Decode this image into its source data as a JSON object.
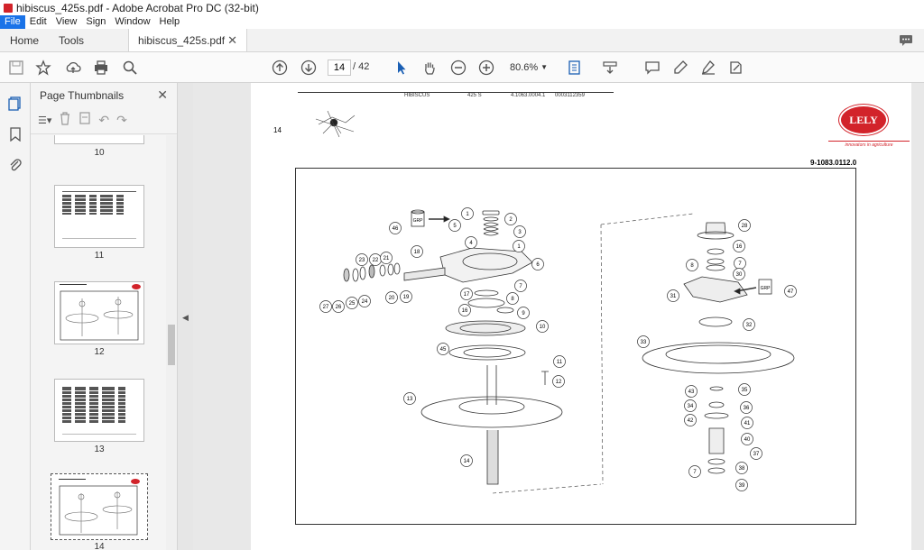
{
  "window": {
    "title": "hibiscus_425s.pdf - Adobe Acrobat Pro DC (32-bit)"
  },
  "menu": {
    "items": [
      "File",
      "Edit",
      "View",
      "Sign",
      "Window",
      "Help"
    ]
  },
  "tabs": {
    "home": "Home",
    "tools": "Tools",
    "document": "hibiscus_425s.pdf"
  },
  "toolbar": {
    "current_page": "14",
    "total_pages": "/ 42",
    "zoom": "80.6%"
  },
  "panel": {
    "title": "Page Thumbnails",
    "thumbnails": [
      {
        "label": "10"
      },
      {
        "label": "11"
      },
      {
        "label": "12"
      },
      {
        "label": "13"
      },
      {
        "label": "14"
      }
    ]
  },
  "page": {
    "header_model": "HIBISCUS",
    "header_type": "425 S",
    "header_code": "4.1063.0004.1",
    "header_serial": "0003112359",
    "page_number": "14",
    "logo_text": "LELY",
    "tagline": "innovators in agriculture",
    "part_ref": "9-1083.0112.0",
    "callouts_left": [
      "46",
      "5",
      "1",
      "2",
      "3",
      "4",
      "1",
      "18",
      "6",
      "23",
      "22",
      "21",
      "27",
      "26",
      "25",
      "24",
      "20",
      "19",
      "7",
      "17",
      "8",
      "16",
      "9",
      "10",
      "45",
      "11",
      "12",
      "13",
      "14"
    ],
    "callouts_right": [
      "28",
      "16",
      "7",
      "8",
      "30",
      "31",
      "47",
      "32",
      "33",
      "43",
      "35",
      "34",
      "36",
      "42",
      "41",
      "40",
      "37",
      "7",
      "38",
      "39"
    ],
    "grp_label": "GRP"
  },
  "colors": {
    "accent": "#d2232a",
    "menu_active": "#1a73e8"
  }
}
